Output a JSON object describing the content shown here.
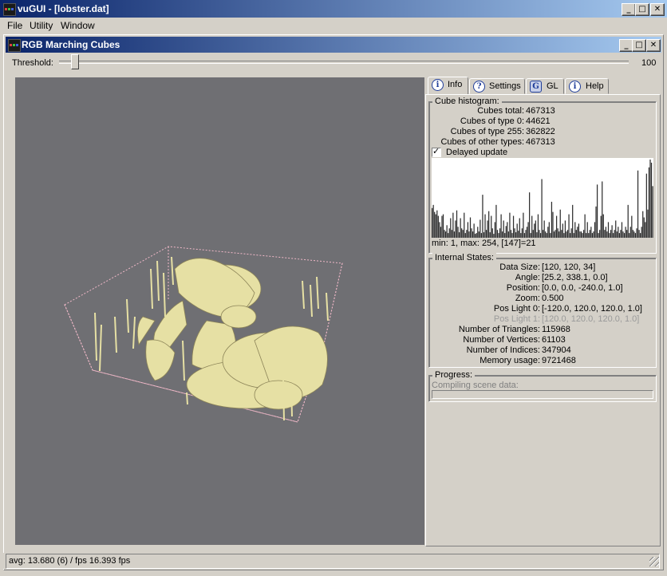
{
  "app": {
    "title": "vuGUI - [lobster.dat]",
    "window_buttons": [
      "_",
      "□",
      "✕"
    ]
  },
  "menu": [
    "File",
    "Utility",
    "Window"
  ],
  "child": {
    "title": "RGB Marching Cubes",
    "window_buttons": [
      "_",
      "□",
      "✕"
    ]
  },
  "threshold": {
    "label": "Threshold:",
    "max_label": "100",
    "value": 10
  },
  "tabs": [
    {
      "label": "Info",
      "icon": "info-icon",
      "active": true
    },
    {
      "label": "Settings",
      "icon": "help-icon",
      "active": false
    },
    {
      "label": "GL",
      "icon": "opengl-icon",
      "active": false
    },
    {
      "label": "Help",
      "icon": "info-icon",
      "active": false
    }
  ],
  "cube_histogram": {
    "title": "Cube histogram:",
    "rows": [
      {
        "key": "Cubes total:",
        "value": "467313"
      },
      {
        "key": "Cubes of type 0:",
        "value": "44621"
      },
      {
        "key": "Cubes of type 255:",
        "value": "362822"
      },
      {
        "key": "Cubes of other types:",
        "value": "467313"
      }
    ],
    "delayed_update_label": "Delayed update",
    "delayed_update_checked": true,
    "range_text": "min: 1, max: 254, [147]=21",
    "bars": [
      0.38,
      0.42,
      0.33,
      0.3,
      0.35,
      0.28,
      0.2,
      0.14,
      0.28,
      0.3,
      0.1,
      0.08,
      0.16,
      0.06,
      0.12,
      0.25,
      0.1,
      0.32,
      0.08,
      0.22,
      0.35,
      0.14,
      0.07,
      0.25,
      0.12,
      0.1,
      0.32,
      0.06,
      0.1,
      0.2,
      0.08,
      0.26,
      0.12,
      0.08,
      0.18,
      0.05,
      0.06,
      0.14,
      0.08,
      0.23,
      0.06,
      0.55,
      0.07,
      0.3,
      0.1,
      0.22,
      0.34,
      0.07,
      0.28,
      0.12,
      0.05,
      0.2,
      0.42,
      0.1,
      0.06,
      0.12,
      0.3,
      0.08,
      0.22,
      0.06,
      0.15,
      0.2,
      0.08,
      0.32,
      0.1,
      0.06,
      0.28,
      0.12,
      0.07,
      0.18,
      0.09,
      0.25,
      0.06,
      0.12,
      0.32,
      0.06,
      0.1,
      0.14,
      0.2,
      0.58,
      0.06,
      0.28,
      0.1,
      0.18,
      0.22,
      0.07,
      0.3,
      0.1,
      0.06,
      0.75,
      0.1,
      0.22,
      0.08,
      0.06,
      0.14,
      0.2,
      0.06,
      0.46,
      0.33,
      0.08,
      0.1,
      0.28,
      0.12,
      0.08,
      0.36,
      0.1,
      0.18,
      0.06,
      0.22,
      0.08,
      0.1,
      0.3,
      0.06,
      0.12,
      0.42,
      0.06,
      0.2,
      0.1,
      0.14,
      0.18,
      0.08,
      0.08,
      0.06,
      0.1,
      0.3,
      0.06,
      0.2,
      0.06,
      0.1,
      0.14,
      0.06,
      0.08,
      0.2,
      0.4,
      0.68,
      0.06,
      0.1,
      0.28,
      0.72,
      0.3,
      0.1,
      0.14,
      0.08,
      0.2,
      0.06,
      0.1,
      0.16,
      0.06,
      0.1,
      0.22,
      0.08,
      0.14,
      0.06,
      0.1,
      0.2,
      0.08,
      0.06,
      0.14,
      0.1,
      0.42,
      0.06,
      0.14,
      0.28,
      0.1,
      0.08,
      0.06,
      0.12,
      0.86,
      0.1,
      0.06,
      0.14,
      0.34,
      0.26,
      0.2,
      0.82,
      0.36,
      0.9,
      1.0,
      0.96,
      0.66
    ]
  },
  "internal_states": {
    "title": "Internal States:",
    "rows": [
      {
        "key": "Data Size:",
        "value": "[120, 120, 34]",
        "disabled": false
      },
      {
        "key": "Angle:",
        "value": "[25.2, 338.1, 0.0]",
        "disabled": false
      },
      {
        "key": "Position:",
        "value": "[0.0, 0.0, -240.0, 1.0]",
        "disabled": false
      },
      {
        "key": "Zoom:",
        "value": "0.500",
        "disabled": false
      },
      {
        "key": "Pos Light 0:",
        "value": "[-120.0, 120.0, 120.0, 1.0]",
        "disabled": false
      },
      {
        "key": "Pos Light 1:",
        "value": "[120.0, 120.0, 120.0, 1.0]",
        "disabled": true
      },
      {
        "key": "Number of Triangles:",
        "value": "115968",
        "disabled": false
      },
      {
        "key": "Number of Vertices:",
        "value": "61103",
        "disabled": false
      },
      {
        "key": "Number of Indices:",
        "value": "347904",
        "disabled": false
      },
      {
        "key": "Memory usage:",
        "value": "9721468",
        "disabled": false
      }
    ]
  },
  "progress": {
    "title": "Progress:",
    "status_text": "Compiling scene data:",
    "value": 0
  },
  "statusbar": {
    "text": "avg: 13.680 (6) / fps 16.393 fps"
  },
  "colors": {
    "title_start": "#0a246a",
    "title_end": "#a6caf0",
    "viewport_bg": "#6f6f73",
    "lobster": "#e6e0a4",
    "bbox": "#f0b8c8"
  }
}
